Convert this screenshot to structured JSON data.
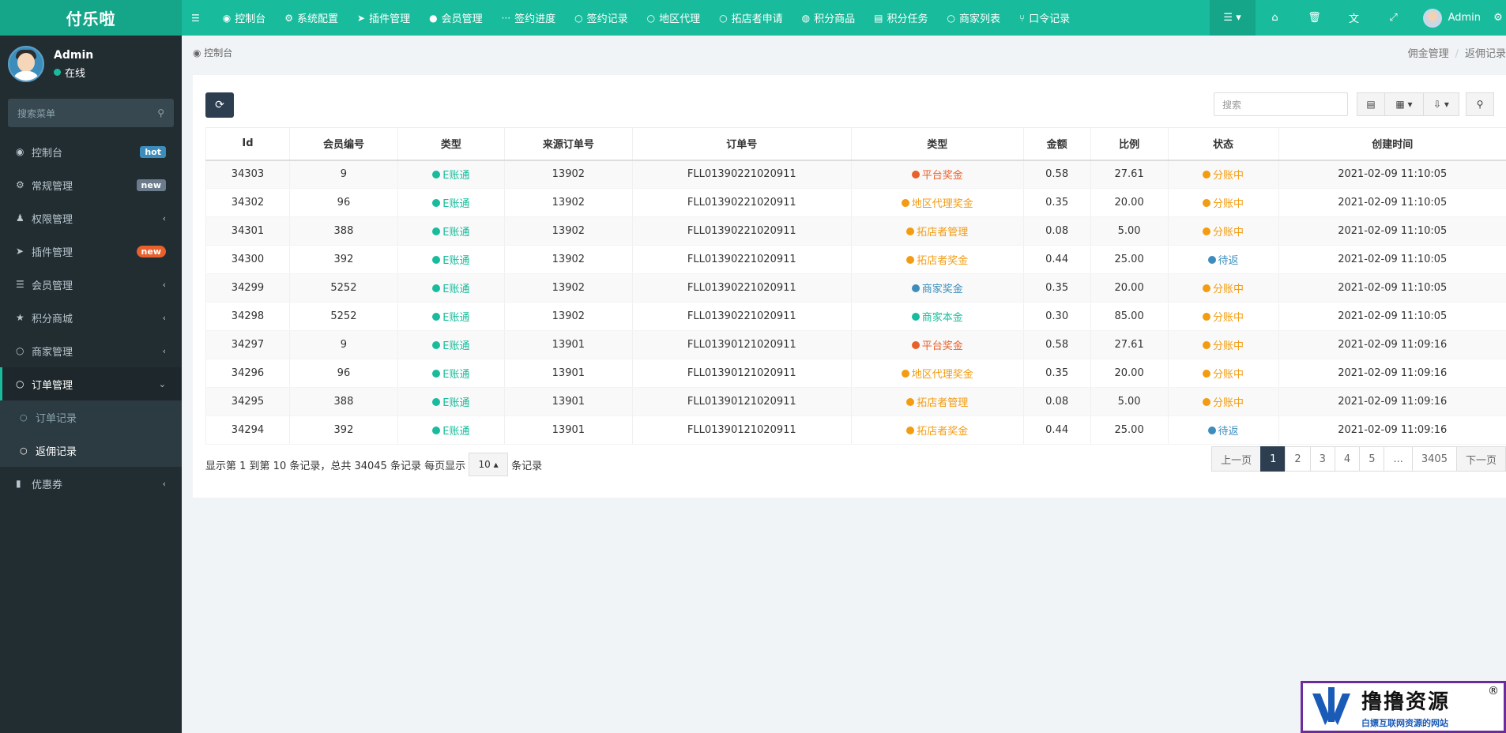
{
  "app": {
    "logo": "付乐啦"
  },
  "topnav": [
    {
      "icon": "☰",
      "icon_name": "menu-toggle-icon",
      "label": ""
    },
    {
      "icon": "◉",
      "icon_name": "dashboard-icon",
      "label": "控制台"
    },
    {
      "icon": "⚙",
      "icon_name": "gear-icon",
      "label": "系统配置"
    },
    {
      "icon": "➤",
      "icon_name": "rocket-icon",
      "label": "插件管理"
    },
    {
      "icon": "●",
      "icon_name": "user-icon",
      "label": "会员管理"
    },
    {
      "icon": "···",
      "icon_name": "ellipsis-icon",
      "label": "签约进度"
    },
    {
      "icon": "○",
      "icon_name": "circle-icon",
      "label": "签约记录"
    },
    {
      "icon": "○",
      "icon_name": "circle-icon",
      "label": "地区代理"
    },
    {
      "icon": "○",
      "icon_name": "circle-icon",
      "label": "拓店者申请"
    },
    {
      "icon": "◍",
      "icon_name": "coin-icon",
      "label": "积分商品"
    },
    {
      "icon": "▤",
      "icon_name": "list-icon",
      "label": "积分任务"
    },
    {
      "icon": "○",
      "icon_name": "circle-icon",
      "label": "商家列表"
    },
    {
      "icon": "⑂",
      "icon_name": "code-fork-icon",
      "label": "口令记录"
    }
  ],
  "topright": {
    "user": "Admin"
  },
  "sidebar": {
    "user": {
      "name": "Admin",
      "status": "在线"
    },
    "search_placeholder": "搜索菜单",
    "items": [
      {
        "icon": "◉",
        "icon_name": "dashboard-icon",
        "label": "控制台",
        "badge": "hot",
        "badge_style": "hot"
      },
      {
        "icon": "⚙",
        "icon_name": "gears-icon",
        "label": "常规管理",
        "badge": "new",
        "badge_style": "new"
      },
      {
        "icon": "♟",
        "icon_name": "group-icon",
        "label": "权限管理",
        "chev": "‹"
      },
      {
        "icon": "➤",
        "icon_name": "rocket-icon",
        "label": "插件管理",
        "badge": "new",
        "badge_style": "new2"
      },
      {
        "icon": "☰",
        "icon_name": "list-icon",
        "label": "会员管理",
        "chev": "‹"
      },
      {
        "icon": "★",
        "icon_name": "star-icon",
        "label": "积分商城",
        "chev": "‹"
      },
      {
        "icon": "○",
        "icon_name": "circle-icon",
        "label": "商家管理",
        "chev": "‹"
      },
      {
        "icon": "○",
        "icon_name": "circle-icon",
        "label": "订单管理",
        "chev": "⌄",
        "active": true
      }
    ],
    "subitems": [
      {
        "label": "订单记录"
      },
      {
        "label": "返佣记录",
        "active": true
      }
    ],
    "after": {
      "icon": "▮",
      "icon_name": "bookmark-icon",
      "label": "优惠券",
      "chev": "‹"
    }
  },
  "breadcrumb": {
    "home": "控制台",
    "parent": "佣金管理",
    "current": "返佣记录",
    "sep": "/"
  },
  "toolbar": {
    "search_placeholder": "搜索"
  },
  "table": {
    "columns": [
      "Id",
      "会员编号",
      "类型",
      "来源订单号",
      "订单号",
      "类型",
      "金额",
      "比例",
      "状态",
      "创建时间"
    ],
    "rows": [
      {
        "id": "34303",
        "member": "9",
        "type": "E账通",
        "src": "13902",
        "order": "FLL01390221020911",
        "kind": "平台奖金",
        "kind_color": "#e8612c",
        "amount": "0.58",
        "ratio": "27.61",
        "status": "分账中",
        "status_color": "#f39c12",
        "time": "2021-02-09 11:10:05"
      },
      {
        "id": "34302",
        "member": "96",
        "type": "E账通",
        "src": "13902",
        "order": "FLL01390221020911",
        "kind": "地区代理奖金",
        "kind_color": "#f39c12",
        "amount": "0.35",
        "ratio": "20.00",
        "status": "分账中",
        "status_color": "#f39c12",
        "time": "2021-02-09 11:10:05"
      },
      {
        "id": "34301",
        "member": "388",
        "type": "E账通",
        "src": "13902",
        "order": "FLL01390221020911",
        "kind": "拓店者管理",
        "kind_color": "#f39c12",
        "amount": "0.08",
        "ratio": "5.00",
        "status": "分账中",
        "status_color": "#f39c12",
        "time": "2021-02-09 11:10:05"
      },
      {
        "id": "34300",
        "member": "392",
        "type": "E账通",
        "src": "13902",
        "order": "FLL01390221020911",
        "kind": "拓店者奖金",
        "kind_color": "#f39c12",
        "amount": "0.44",
        "ratio": "25.00",
        "status": "待返",
        "status_color": "#3c8dbc",
        "time": "2021-02-09 11:10:05"
      },
      {
        "id": "34299",
        "member": "5252",
        "type": "E账通",
        "src": "13902",
        "order": "FLL01390221020911",
        "kind": "商家奖金",
        "kind_color": "#3c8dbc",
        "amount": "0.35",
        "ratio": "20.00",
        "status": "分账中",
        "status_color": "#f39c12",
        "time": "2021-02-09 11:10:05"
      },
      {
        "id": "34298",
        "member": "5252",
        "type": "E账通",
        "src": "13902",
        "order": "FLL01390221020911",
        "kind": "商家本金",
        "kind_color": "#18bc9c",
        "amount": "0.30",
        "ratio": "85.00",
        "status": "分账中",
        "status_color": "#f39c12",
        "time": "2021-02-09 11:10:05"
      },
      {
        "id": "34297",
        "member": "9",
        "type": "E账通",
        "src": "13901",
        "order": "FLL01390121020911",
        "kind": "平台奖金",
        "kind_color": "#e8612c",
        "amount": "0.58",
        "ratio": "27.61",
        "status": "分账中",
        "status_color": "#f39c12",
        "time": "2021-02-09 11:09:16"
      },
      {
        "id": "34296",
        "member": "96",
        "type": "E账通",
        "src": "13901",
        "order": "FLL01390121020911",
        "kind": "地区代理奖金",
        "kind_color": "#f39c12",
        "amount": "0.35",
        "ratio": "20.00",
        "status": "分账中",
        "status_color": "#f39c12",
        "time": "2021-02-09 11:09:16"
      },
      {
        "id": "34295",
        "member": "388",
        "type": "E账通",
        "src": "13901",
        "order": "FLL01390121020911",
        "kind": "拓店者管理",
        "kind_color": "#f39c12",
        "amount": "0.08",
        "ratio": "5.00",
        "status": "分账中",
        "status_color": "#f39c12",
        "time": "2021-02-09 11:09:16"
      },
      {
        "id": "34294",
        "member": "392",
        "type": "E账通",
        "src": "13901",
        "order": "FLL01390121020911",
        "kind": "拓店者奖金",
        "kind_color": "#f39c12",
        "amount": "0.44",
        "ratio": "25.00",
        "status": "待返",
        "status_color": "#3c8dbc",
        "time": "2021-02-09 11:09:16"
      }
    ]
  },
  "footer": {
    "info_prefix": "显示第 1 到第 10 条记录，总共 34045 条记录 每页显示",
    "page_size": "10 ▴",
    "info_suffix": "条记录",
    "pages": [
      "上一页",
      "1",
      "2",
      "3",
      "4",
      "5",
      "...",
      "3405",
      "下一页"
    ],
    "current_page": "1"
  },
  "watermark": {
    "main": "撸撸资源",
    "sub": "白嫖互联网资源的网站",
    "reg": "®"
  },
  "colors": {
    "accent": "#18bc9c",
    "sidebar": "#222d32",
    "primary_dark": "#2c3e50"
  }
}
